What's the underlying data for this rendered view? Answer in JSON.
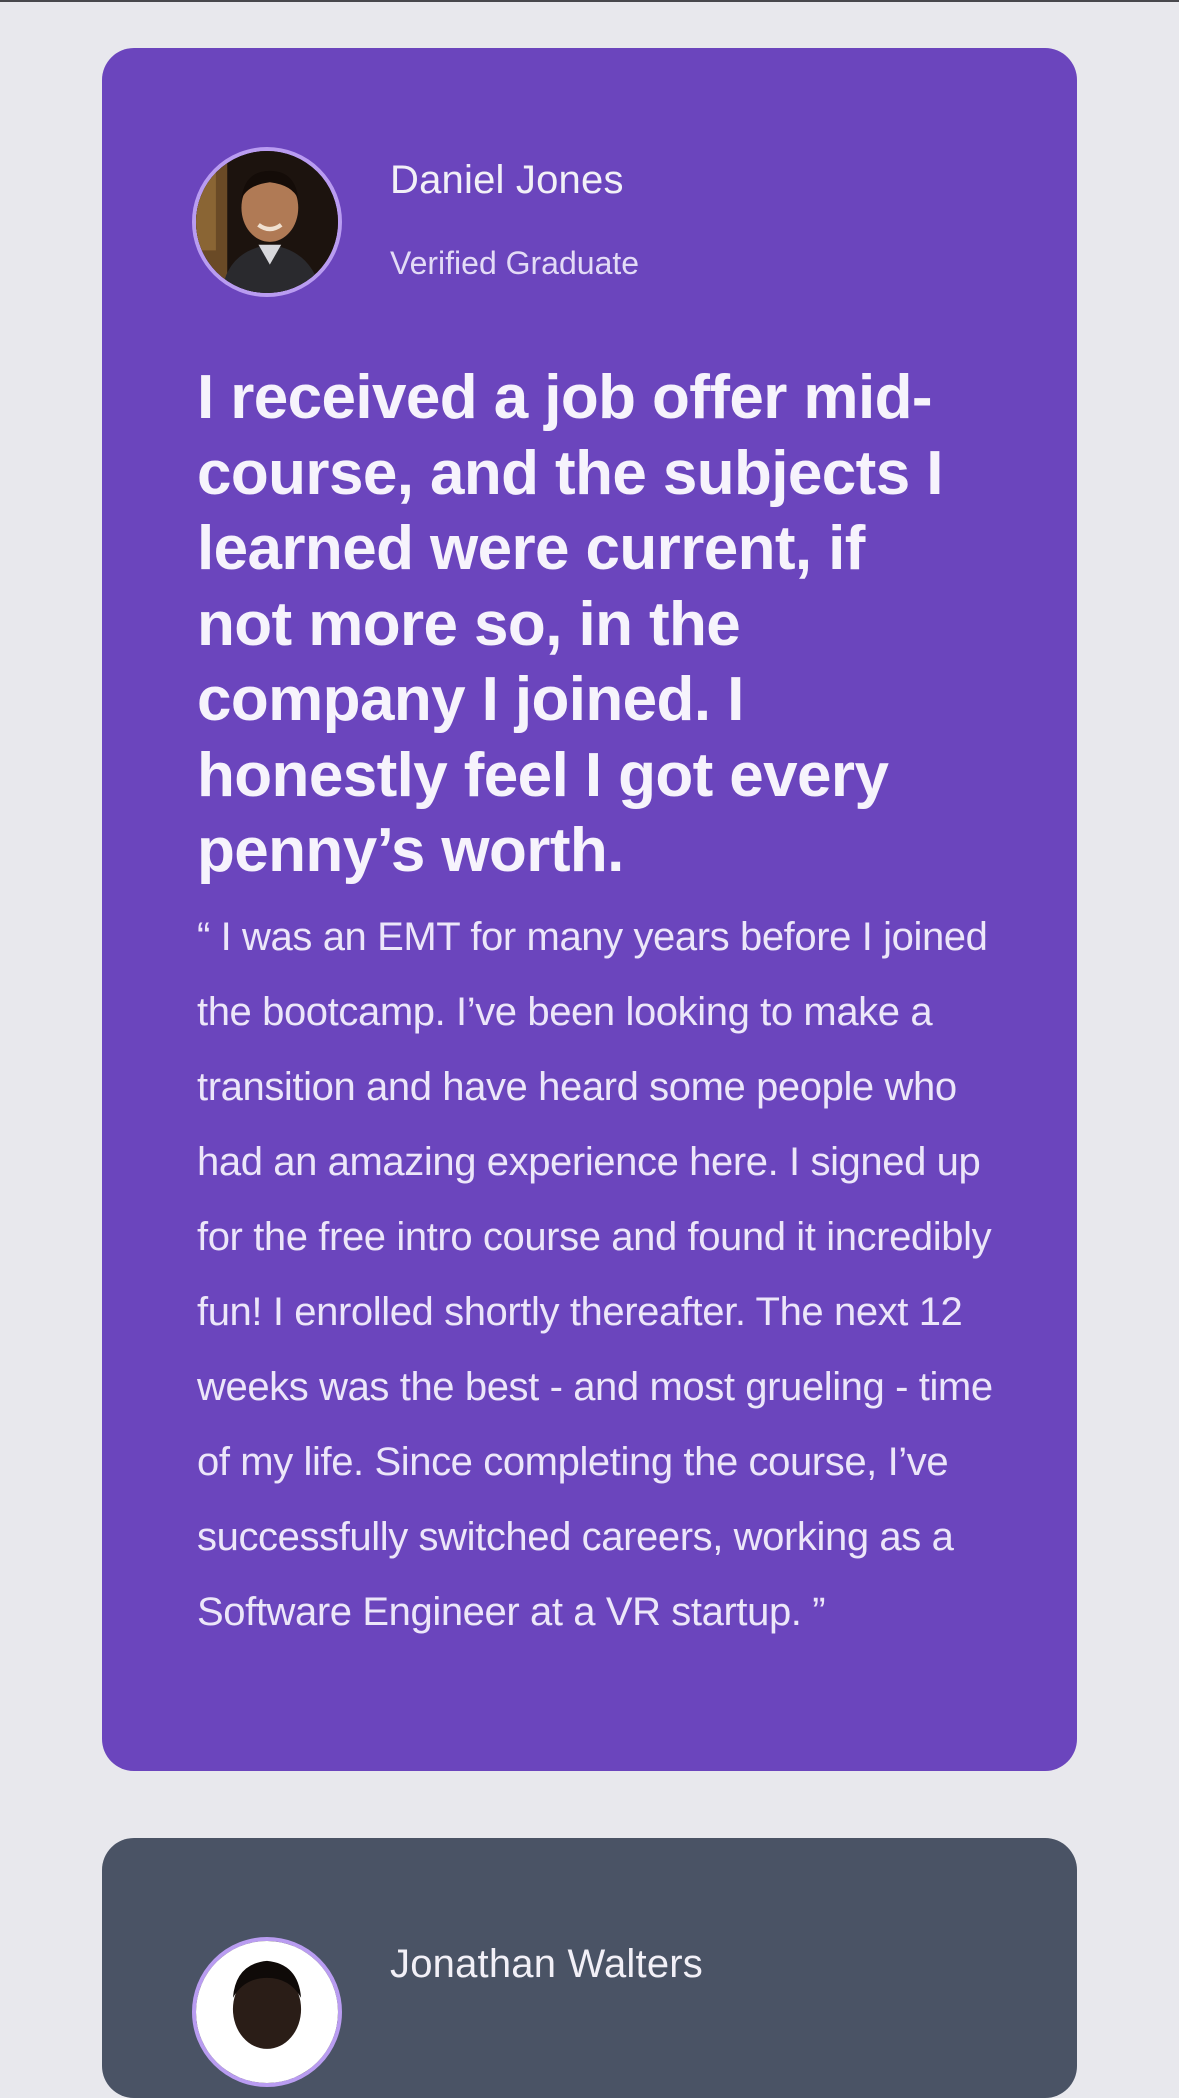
{
  "testimonials": [
    {
      "name": "Daniel Jones",
      "role": "Verified Graduate",
      "headline": "I received a job offer mid-course, and the subjects I learned were current, if not more so, in the company I joined. I honestly feel I got every penny’s worth.",
      "quote": "“ I was an EMT for many years before I joined the bootcamp. I’ve been looking to make a transition and have heard some people who had an amazing experience here. I signed up for the free intro course and found it incredibly fun! I enrolled shortly thereafter. The next 12 weeks was the best - and most grueling - time of my life. Since completing the course, I’ve successfully switched careers, working as a Software Engineer at a VR startup. ”",
      "card_color": "#6b45bd"
    },
    {
      "name": "Jonathan Walters",
      "card_color": "#4a5365"
    }
  ],
  "colors": {
    "page_background": "#e8e8ed",
    "avatar_ring": "#b99cf1"
  }
}
